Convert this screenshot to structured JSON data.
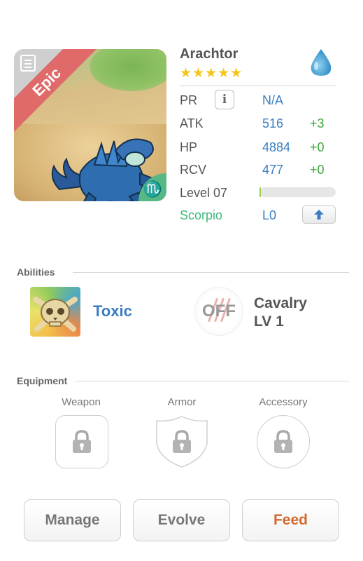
{
  "monster": {
    "name": "Arachtor",
    "rarity": "Epic",
    "stars": "★★★★★",
    "element_icon": "water-drop-icon",
    "sign_symbol": "♏",
    "colors": {
      "rarity": "#e06a6a",
      "star": "#f5c518",
      "element": "#4aa7d8",
      "stat_value": "#3a7dc2",
      "bonus": "#3fa83f"
    }
  },
  "stats": {
    "pr": {
      "label": "PR",
      "value": "N/A"
    },
    "atk": {
      "label": "ATK",
      "value": "516",
      "bonus": "+3"
    },
    "hp": {
      "label": "HP",
      "value": "4884",
      "bonus": "+0"
    },
    "rcv": {
      "label": "RCV",
      "value": "477",
      "bonus": "+0"
    },
    "level": {
      "label": "Level 07",
      "progress": 0.02
    },
    "sign": {
      "label": "Scorpio",
      "value": "L0"
    },
    "info_glyph": "i"
  },
  "abilities": {
    "title": "Abilities",
    "active": {
      "name": "Toxic"
    },
    "passive": {
      "state": "OFF",
      "name": "Cavalry",
      "level": "LV 1"
    }
  },
  "equipment": {
    "title": "Equipment",
    "slots": [
      {
        "label": "Weapon"
      },
      {
        "label": "Armor"
      },
      {
        "label": "Accessory"
      }
    ]
  },
  "actions": {
    "manage": "Manage",
    "evolve": "Evolve",
    "feed": "Feed"
  }
}
